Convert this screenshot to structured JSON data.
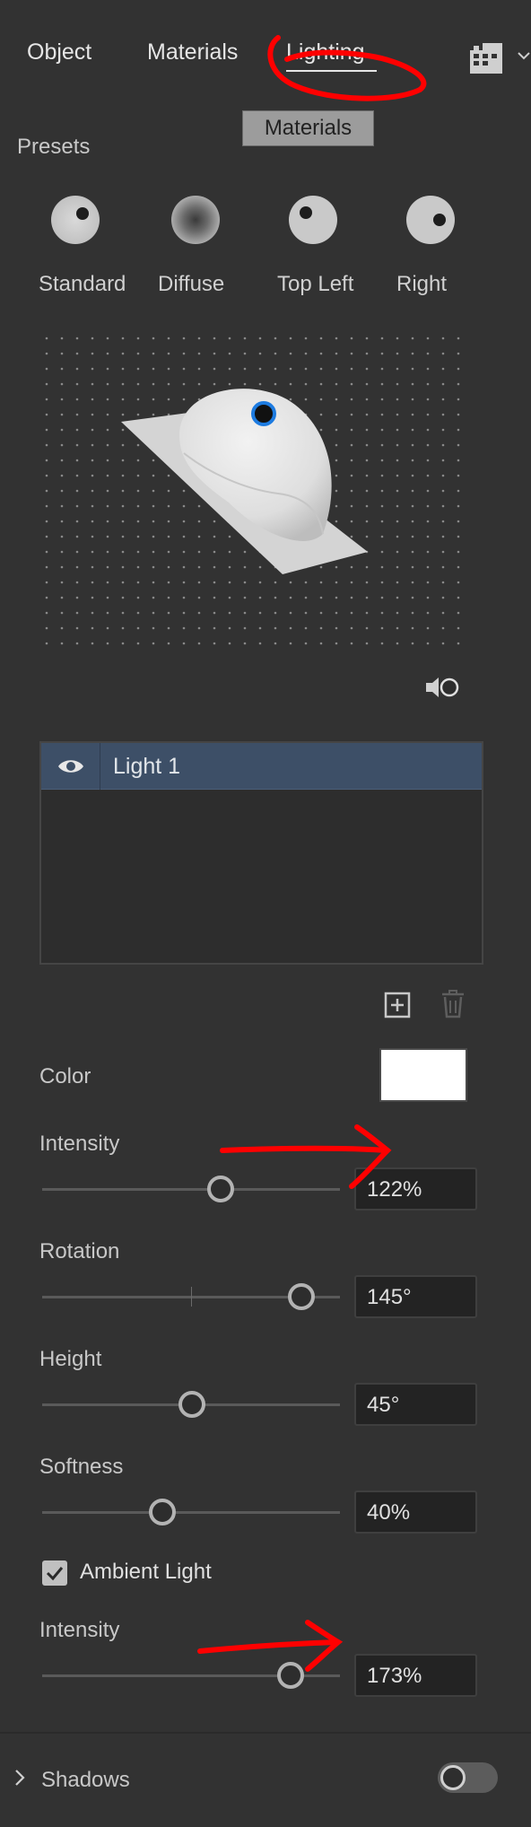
{
  "tabs": [
    {
      "label": "Object"
    },
    {
      "label": "Materials"
    },
    {
      "label": "Lighting"
    }
  ],
  "tooltip": "Materials",
  "presets": {
    "heading": "Presets",
    "items": [
      {
        "label": "Standard"
      },
      {
        "label": "Diffuse"
      },
      {
        "label": "Top Left"
      },
      {
        "label": "Right"
      }
    ]
  },
  "lights": {
    "items": [
      {
        "name": "Light 1",
        "visible": true
      }
    ]
  },
  "properties": {
    "color": {
      "label": "Color",
      "value": "#ffffff"
    },
    "intensity": {
      "label": "Intensity",
      "value": "122%"
    },
    "rotation": {
      "label": "Rotation",
      "value": "145°"
    },
    "height": {
      "label": "Height",
      "value": "45°"
    },
    "softness": {
      "label": "Softness",
      "value": "40%"
    },
    "ambient": {
      "checkbox_label": "Ambient Light",
      "checked": true,
      "intensity_label": "Intensity",
      "intensity_value": "173%"
    }
  },
  "shadows": {
    "label": "Shadows",
    "enabled": false
  },
  "colors": {
    "panel_bg": "#323232",
    "selected_row": "#3d4f67",
    "light_handle": "#1d7be0",
    "annotation": "#ff0000"
  }
}
